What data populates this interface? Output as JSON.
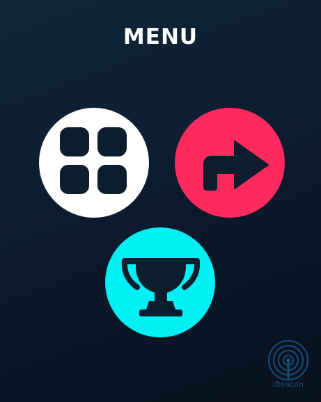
{
  "menu": {
    "title": "MENU",
    "buttons": [
      {
        "id": "grid",
        "icon": "grid-icon",
        "color": "#ffffff",
        "icon_color": "#0c1d2e"
      },
      {
        "id": "next",
        "icon": "arrow-right-icon",
        "color": "#ff2a5e",
        "icon_color": "#0c1d2e"
      },
      {
        "id": "trophy",
        "icon": "trophy-icon",
        "color": "#00f0f5",
        "icon_color": "#0c1d2e"
      }
    ]
  },
  "branding": {
    "logo_text": "iBeacon",
    "logo_icon": "broadcast-icon",
    "color": "#1e5a87"
  },
  "colors": {
    "background_top": "#10263a",
    "background_bottom": "#07111f"
  }
}
